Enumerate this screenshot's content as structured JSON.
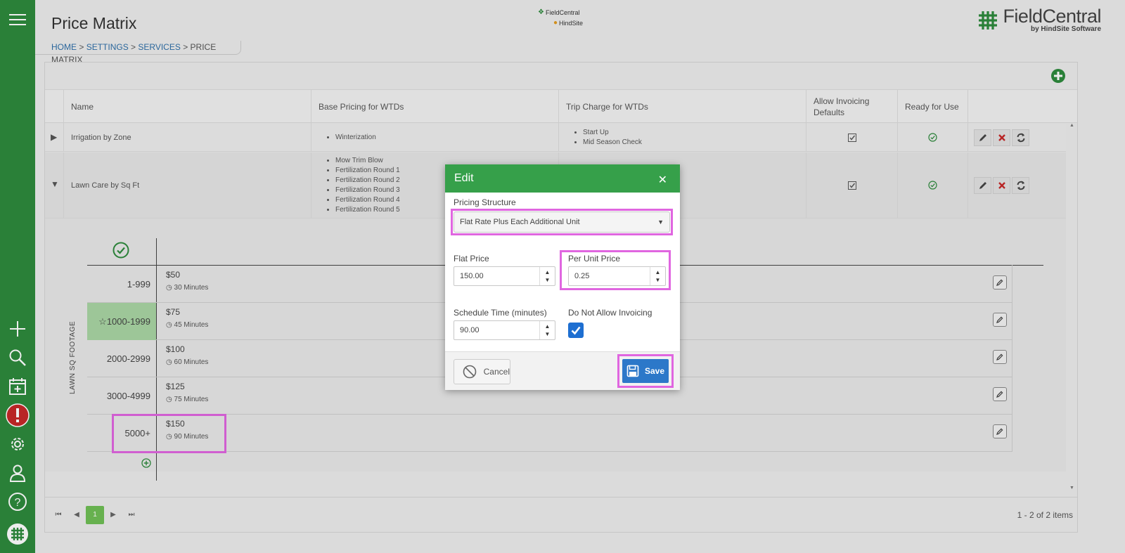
{
  "app": {
    "page_title": "Price Matrix",
    "breadcrumb": [
      {
        "label": "HOME",
        "link": true
      },
      {
        "label": " > ",
        "link": false
      },
      {
        "label": "SETTINGS",
        "link": true
      },
      {
        "label": " > ",
        "link": false
      },
      {
        "label": "SERVICES",
        "link": true
      },
      {
        "label": " > ",
        "link": false
      },
      {
        "label": "PRICE MATRIX",
        "link": false
      }
    ],
    "center_logo_top": "FieldCentral",
    "center_logo_bottom": "HindSite",
    "brand_name": "FieldCentral",
    "brand_sub": "by HindSite Software"
  },
  "sidebar": {
    "icons": [
      "menu-icon",
      "plus-icon",
      "search-icon",
      "calendar-add-icon",
      "alert-icon",
      "gear-icon",
      "user-icon",
      "help-icon",
      "logo-icon"
    ],
    "colors": {
      "bg": "#2e8a3d",
      "alert": "#c62828"
    }
  },
  "table": {
    "columns": [
      "Name",
      "Base Pricing for WTDs",
      "Trip Charge for WTDs",
      "Allow Invoicing Defaults",
      "Ready for Use"
    ],
    "rows": [
      {
        "name": "Irrigation by Zone",
        "base_pricing": [
          "Winterization"
        ],
        "trip_charge": [
          "Start Up",
          "Mid Season Check"
        ],
        "allow_invoicing": true,
        "ready": true
      },
      {
        "name": "Lawn Care by Sq Ft",
        "base_pricing": [
          "Mow Trim Blow",
          "Fertilization Round 1",
          "Fertilization Round 2",
          "Fertilization Round 3",
          "Fertilization Round 4",
          "Fertilization Round 5"
        ],
        "trip_charge": [],
        "allow_invoicing": true,
        "ready": true
      }
    ]
  },
  "matrix": {
    "axis_label": "LAWN SQ FOOTAGE",
    "tiers": [
      {
        "range": "1-999",
        "price": "$50",
        "time": "30 Minutes",
        "default": false
      },
      {
        "range": "1000-1999",
        "price": "$75",
        "time": "45 Minutes",
        "default": true
      },
      {
        "range": "2000-2999",
        "price": "$100",
        "time": "60 Minutes",
        "default": false
      },
      {
        "range": "3000-4999",
        "price": "$125",
        "time": "75 Minutes",
        "default": false
      },
      {
        "range": "5000+",
        "price": "$150",
        "time": "90 Minutes",
        "default": false
      }
    ]
  },
  "pager": {
    "current_page": "1",
    "info": "1 - 2 of 2 items"
  },
  "modal": {
    "title": "Edit",
    "pricing_structure_label": "Pricing Structure",
    "pricing_structure_value": "Flat Rate Plus Each Additional Unit",
    "flat_price_label": "Flat Price",
    "flat_price_value": "150.00",
    "per_unit_label": "Per Unit Price",
    "per_unit_value": "0.25",
    "schedule_label": "Schedule Time (minutes)",
    "schedule_value": "90.00",
    "no_invoice_label": "Do Not Allow Invoicing",
    "no_invoice_checked": true,
    "cancel_label": "Cancel",
    "save_label": "Save",
    "colors": {
      "header": "#36a04a",
      "save": "#2c78c9",
      "highlight": "#e066e0"
    }
  }
}
